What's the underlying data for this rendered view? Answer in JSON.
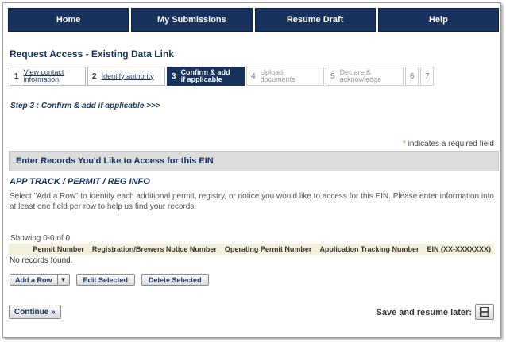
{
  "nav": {
    "items": [
      "Home",
      "My Submissions",
      "Resume Draft",
      "Help"
    ]
  },
  "page_title": "Request Access - Existing Data Link",
  "wizard": {
    "steps": [
      {
        "num": "1",
        "label": "View contact information",
        "state": "done"
      },
      {
        "num": "2",
        "label": "Identify authority",
        "state": "done"
      },
      {
        "num": "3",
        "label": "Confirm & add if applicable",
        "state": "active"
      },
      {
        "num": "4",
        "label": "Upload documents",
        "state": "disabled"
      },
      {
        "num": "5",
        "label": "Declare & acknowledge",
        "state": "disabled"
      },
      {
        "num": "6",
        "label": "",
        "state": "disabled"
      },
      {
        "num": "7",
        "label": "",
        "state": "disabled"
      }
    ]
  },
  "step_heading": "Step 3 : Confirm & add if applicable >>>",
  "required": {
    "star": "*",
    "text": "indicates a required field"
  },
  "section_title": "Enter Records You'd Like to Access for this EIN",
  "app_title": "APP TRACK / PERMIT / REG INFO",
  "description": "Select \"Add a Row\" to identify each additional permit, registry, or notice you would like to access for this EIN. Please enter information into at least one field per row to help us find your records.",
  "table": {
    "showing": "Showing 0-0 of 0",
    "columns": [
      "Permit Number",
      "Registration/Brewers Notice Number",
      "Operating Permit Number",
      "Application Tracking Number",
      "EIN (XX-XXXXXXX)"
    ],
    "empty": "No records found."
  },
  "buttons": {
    "add_row": "Add a Row",
    "edit_selected": "Edit Selected",
    "delete_selected": "Delete Selected",
    "continue": "Continue »",
    "save_resume": "Save and resume later:"
  },
  "icons": {
    "dropdown": "caret-down-icon",
    "save": "floppy-disk-icon"
  },
  "colors": {
    "brand_navy": "#17325d",
    "section_grey": "#dcdcdc",
    "table_header": "#f5f0dc",
    "required_star": "#d9822b"
  }
}
